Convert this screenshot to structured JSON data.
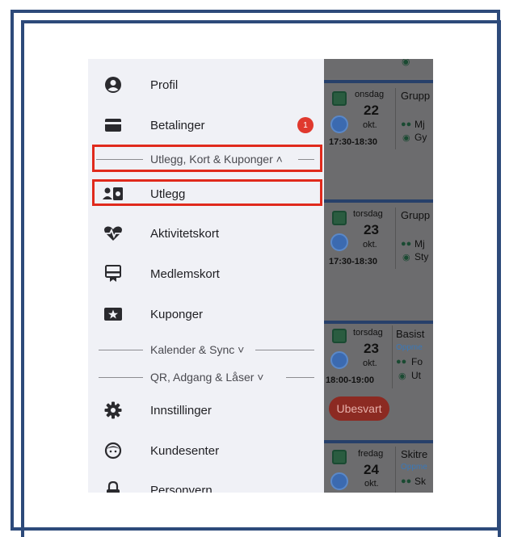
{
  "menu": {
    "profile_label": "Profil",
    "payments_label": "Betalinger",
    "payments_badge": "1",
    "section_expenses": "Utlegg, Kort & Kuponger ˄",
    "expenses_label": "Utlegg",
    "activity_card_label": "Aktivitetskort",
    "member_card_label": "Medlemskort",
    "coupons_label": "Kuponger",
    "section_calendar": "Kalender & Sync ˅",
    "section_qr": "QR, Adgang & Låser ˅",
    "settings_label": "Innstillinger",
    "support_label": "Kundesenter",
    "privacy_label": "Personvern"
  },
  "cards": [
    {
      "day": "onsdag",
      "date": "22",
      "month": "okt.",
      "time": "17:30-18:30",
      "title": "Grupp",
      "line1": "Mj",
      "line2": "Gy"
    },
    {
      "day": "torsdag",
      "date": "23",
      "month": "okt.",
      "time": "17:30-18:30",
      "title": "Grupp",
      "line1": "Mj",
      "line2": "Sty"
    },
    {
      "day": "torsdag",
      "date": "23",
      "month": "okt.",
      "time": "18:00-19:00",
      "title": "Basist",
      "status": "Oppme",
      "line1": "Fo",
      "line2": "Ut",
      "button": "Ubesvart"
    },
    {
      "day": "fredag",
      "date": "24",
      "month": "okt.",
      "title": "Skitre",
      "status": "Oppme",
      "line1": "Sk"
    }
  ],
  "colors": {
    "highlight": "#e02a1c",
    "frame": "#2d4a7a",
    "badge": "#e0392e"
  }
}
